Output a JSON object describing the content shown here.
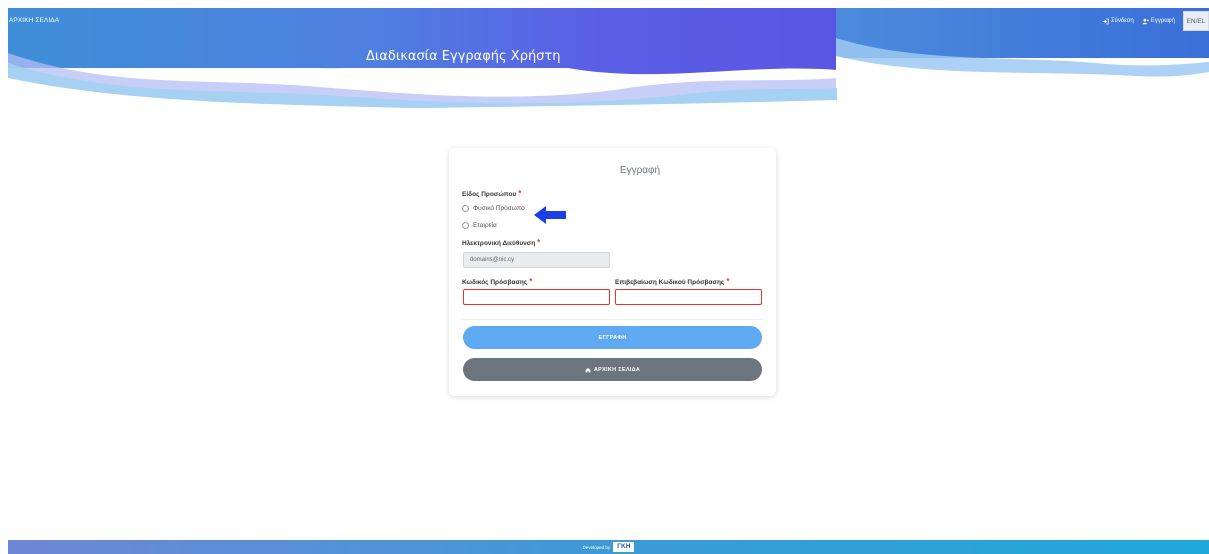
{
  "header": {
    "home_link": "ΑΡΧΙΚΗ ΣΕΛΙΔΑ",
    "page_title": "Διαδικασία Εγγραφής Χρήστη",
    "login_link": "Σύνδεση",
    "register_link": "Εγγραφή",
    "language_button": "EN/EL"
  },
  "form": {
    "title": "Εγγραφή",
    "person_type_label": "Είδος Προσώπου",
    "required_marker": "*",
    "options": [
      "Φυσικό Πρόσωπο",
      "Εταιρεία"
    ],
    "email_label": "Ηλεκτρονική Διεύθυνση",
    "email_value": "domains@nic.cy",
    "password_label": "Κωδικός Πρόσβασης",
    "password_confirm_label": "Επιβεβαίωση Κωδικού Πρόσβασης",
    "submit_label": "ΕΓΓΡΑΦΗ",
    "home_button_label": "ΑΡΧΙΚΗ ΣΕΛΙΔΑ"
  },
  "footer": {
    "developed_by": "Developed by",
    "logo_text": "ΓΚΗ"
  },
  "colors": {
    "primary_button": "#5fa9f2",
    "secondary_button": "#6c757d",
    "required": "#e3342f",
    "annotation_arrow": "#1a3ee8"
  },
  "icons": [
    "sign-in-icon",
    "user-plus-icon",
    "home-icon",
    "arrow-left-icon"
  ]
}
